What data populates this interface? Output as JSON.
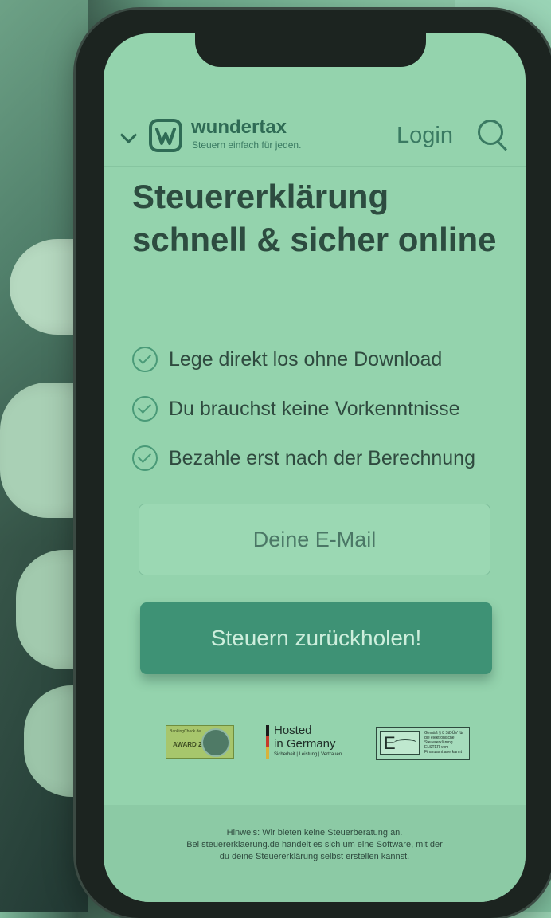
{
  "header": {
    "brand": "wundertax",
    "tagline": "Steuern einfach für jeden.",
    "login_label": "Login"
  },
  "hero": {
    "title": "Steuererklärung schnell & sicher online"
  },
  "features": [
    "Lege direkt los ohne Download",
    "Du brauchst keine Vorkenntnisse",
    "Bezahle erst nach der Berechnung"
  ],
  "form": {
    "email_placeholder": "Deine E-Mail",
    "cta_label": "Steuern zurückholen!"
  },
  "badges": {
    "award_text": "BankingCheck.de",
    "award_year": "AWARD 2018",
    "hosted_line1": "Hosted",
    "hosted_line2": "in Germany",
    "hosted_line3": "Sicherheit | Leistung | Vertrauen",
    "elster_text": "Gemäß § 8 StDÜV für die elektronische Steuererklärung ELSTER vom Finanzamt anerkannt"
  },
  "footer": {
    "note_line1": "Hinweis: Wir bieten keine Steuerberatung an.",
    "note_line2": "Bei steuererklaerung.de handelt es sich um eine Software, mit der",
    "note_line3": "du deine Steuererklärung selbst erstellen kannst."
  },
  "colors": {
    "accent": "#3e9275",
    "screen_bg": "#94d3ad",
    "text_dark": "#2d4c40"
  }
}
